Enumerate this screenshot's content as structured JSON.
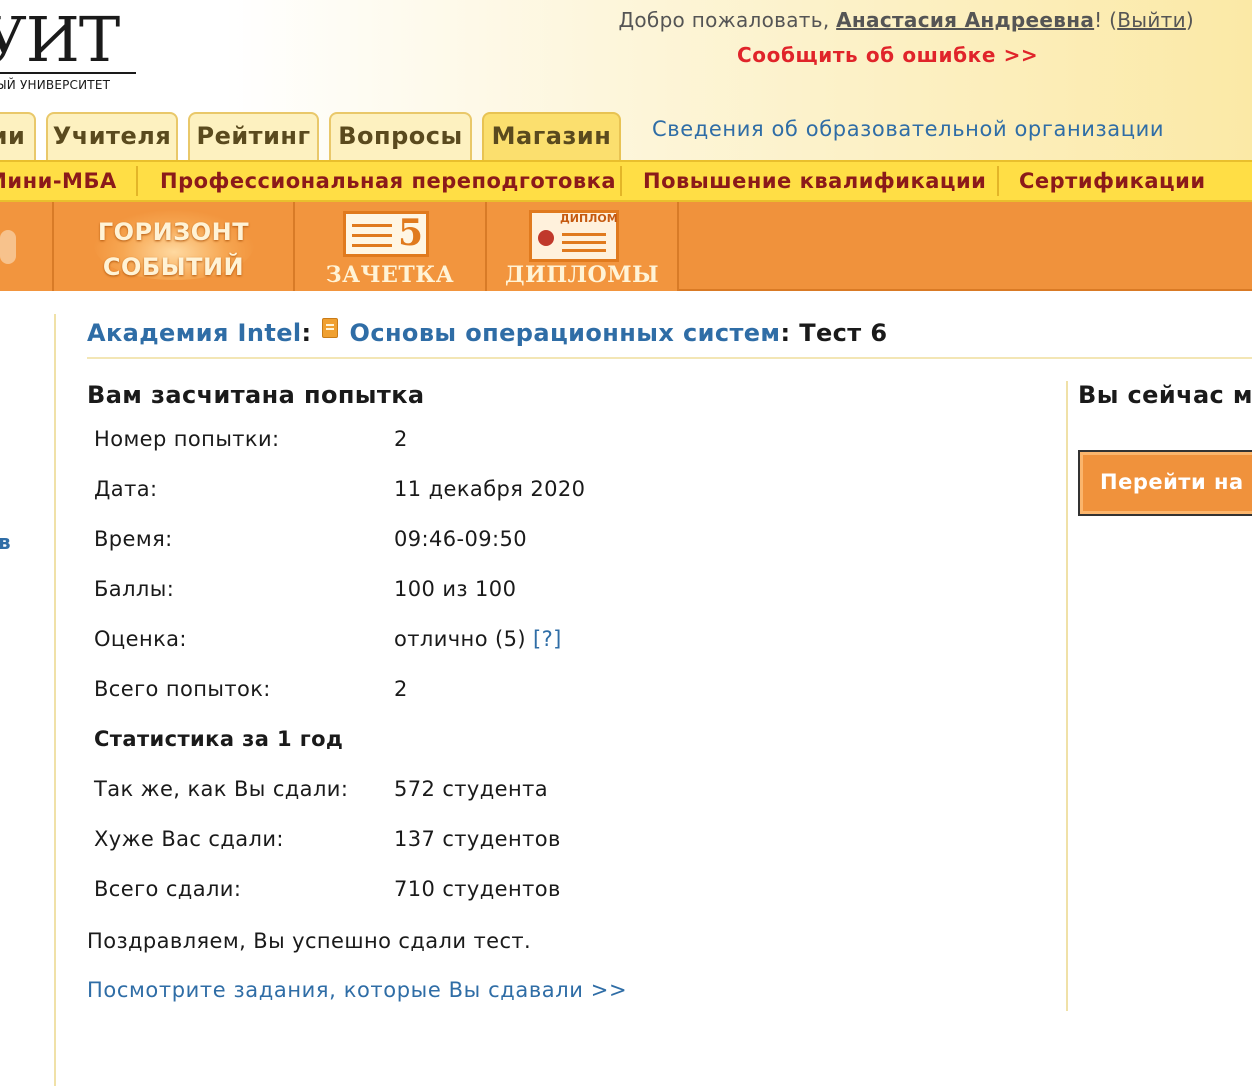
{
  "header": {
    "logo_word": "УИТ",
    "logo_sub": "ЫЙ УНИВЕРСИТЕТ",
    "welcome_prefix": "Добро пожаловать, ",
    "user_name": "Анастасия Андреевна",
    "welcome_bang": "! (",
    "logout": "Выйти",
    "close_paren": ")",
    "report_error": "Сообщить об ошибке >>"
  },
  "tabs": [
    "ии",
    "Учителя",
    "Рейтинг",
    "Вопросы",
    "Магазин"
  ],
  "info_link": "Сведения об образовательной организации",
  "nav": [
    "Мини-МБА",
    "Профессиональная переподготовка",
    "Повышение квалификации",
    "Сертификации"
  ],
  "orange_tiles": {
    "horizon_line1": "ГОРИЗОНТ",
    "horizon_line2": "СОБЫТИЙ",
    "gradebook": "ЗАЧЕТКА",
    "gradebook_digit": "5",
    "diplomas": "ДИПЛОМЫ",
    "diploma_tag": "ДИПЛОМ"
  },
  "left_fragment": "в",
  "breadcrumb": {
    "academy": "Академия Intel",
    "sep1": ":",
    "course": "Основы операционных систем",
    "sep2": ":",
    "test": "Тест 6"
  },
  "result": {
    "title": "Вам засчитана попытка",
    "attempt_label": "Номер попытки:",
    "attempt_value": "2",
    "date_label": "Дата:",
    "date_value": "11 декабря 2020",
    "time_label": "Время:",
    "time_value": "09:46-09:50",
    "score_label": "Баллы:",
    "score_value": "100 из 100",
    "grade_label": "Оценка:",
    "grade_value": "отлично (5)",
    "grade_help": "[?]",
    "total_attempts_label": "Всего попыток:",
    "total_attempts_value": "2",
    "stats_title": "Статистика за 1 год",
    "same_label": "Так же, как Вы сдали:",
    "same_value": "572 студента",
    "worse_label": "Хуже Вас сдали:",
    "worse_value": "137 студентов",
    "total_label": "Всего сдали:",
    "total_value": "710 студентов"
  },
  "congrats": "Поздравляем, Вы успешно сдали тест.",
  "view_tasks": "Посмотрите задания, которые Вы сдавали >>",
  "sidebar": {
    "title": "Вы сейчас мо",
    "button": "Перейти на с"
  },
  "colors": {
    "link": "#2f6da6",
    "error": "#e0242a",
    "nav_text": "#8b1a1a",
    "nav_bg": "#ffde45",
    "orange_bar": "#f0923c"
  }
}
